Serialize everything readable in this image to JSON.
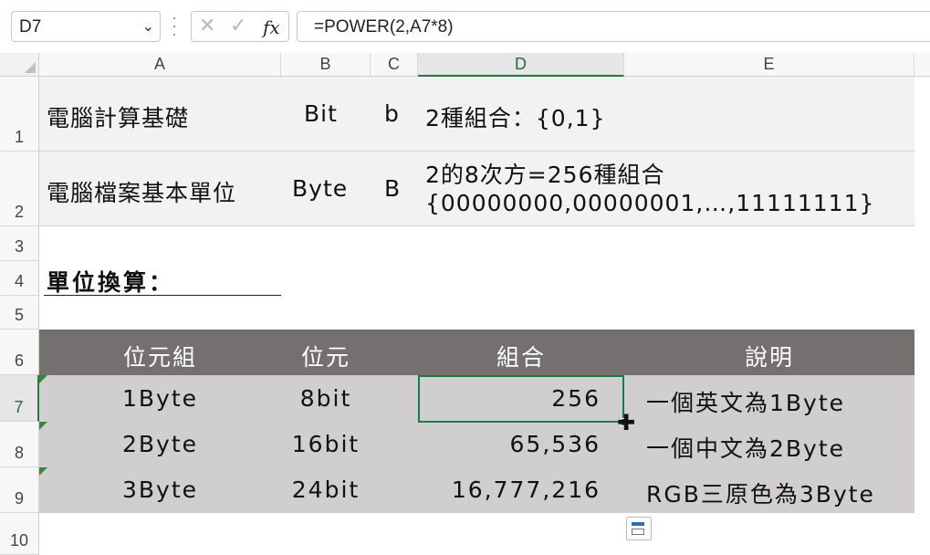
{
  "formula_bar": {
    "name_box": "D7",
    "name_box_chevron": "chevron-down-icon",
    "cancel_icon": "✕",
    "enter_icon": "✓",
    "fx_label": "fx",
    "formula": "=POWER(2,A7*8)"
  },
  "columns": [
    "A",
    "B",
    "C",
    "D",
    "E"
  ],
  "rows": [
    "1",
    "2",
    "3",
    "4",
    "5",
    "6",
    "7",
    "8",
    "9",
    "10"
  ],
  "info": {
    "r1": {
      "a": "電腦計算基礎",
      "b": "Bit",
      "c": "b",
      "d": "2種組合：{0,1}"
    },
    "r2": {
      "a": "電腦檔案基本單位",
      "b": "Byte",
      "c": "B",
      "d_line1": "2的8次方=256種組合",
      "d_line2": "{00000000,00000001,…,11111111}"
    }
  },
  "section_title": "單位換算：",
  "table": {
    "headers": [
      "位元組",
      "位元",
      "組合",
      "說明"
    ],
    "rows": [
      [
        "1Byte",
        "8bit",
        "256",
        "一個英文為1Byte"
      ],
      [
        "2Byte",
        "16bit",
        "65,536",
        "一個中文為2Byte"
      ],
      [
        "3Byte",
        "24bit",
        "16,777,216",
        "RGB三原色為3Byte"
      ]
    ]
  },
  "colors": {
    "header_band": "#757070",
    "table_band": "#d0cece",
    "info_band": "#f2f2f2",
    "selection": "#1f7a45",
    "error_triangle": "#2e8b3e"
  }
}
